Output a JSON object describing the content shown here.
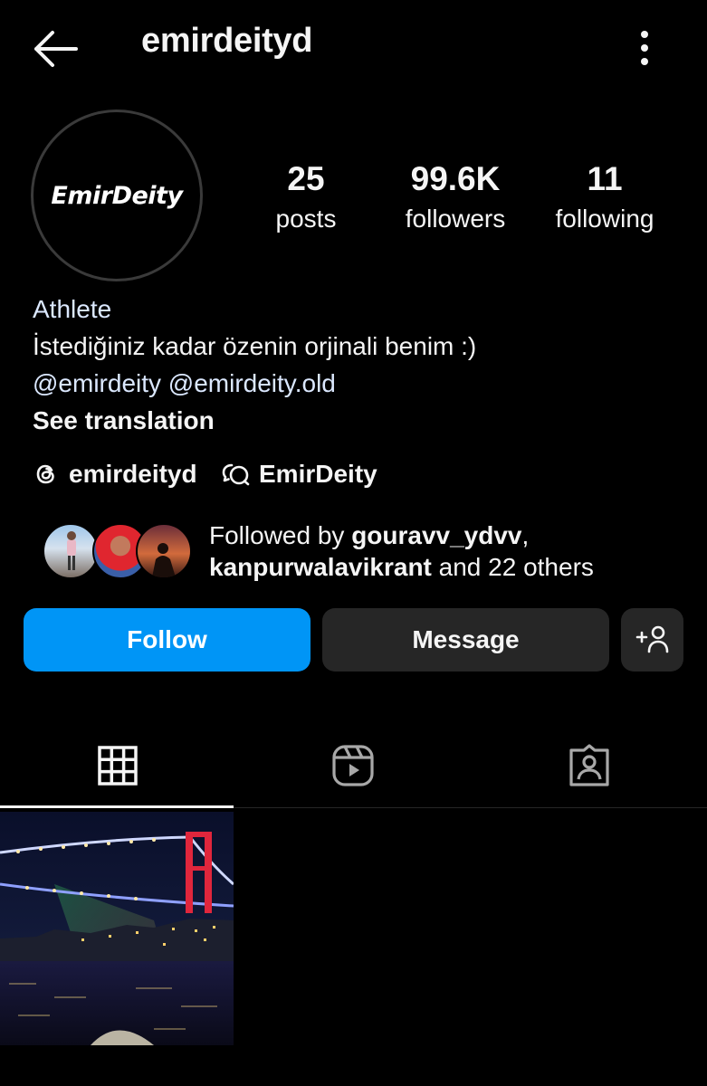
{
  "header": {
    "username": "emirdeityd",
    "back_icon": "arrow-left-icon",
    "more_icon": "more-vertical-icon"
  },
  "profile": {
    "avatar_text": "EmirDeity",
    "stats": [
      {
        "value": "25",
        "label": "posts"
      },
      {
        "value": "99.6K",
        "label": "followers"
      },
      {
        "value": "11",
        "label": "following"
      }
    ],
    "category": "Athlete",
    "bio": "İstediğiniz kadar özenin orjinali benim :)",
    "mentions": "@emirdeity @emirdeity.old",
    "see_translation": "See translation",
    "threads_handle": "emirdeityd",
    "community_name": "EmirDeity"
  },
  "followed_by": {
    "prefix": "Followed by ",
    "user1": "gouravv_ydvv",
    "separator": ",",
    "user2": "kanpurwalavikrant",
    "suffix": " and 22 others"
  },
  "actions": {
    "follow_label": "Follow",
    "message_label": "Message",
    "suggest_icon": "add-person-icon"
  },
  "tabs": [
    {
      "name": "posts",
      "icon": "grid-icon",
      "active": true
    },
    {
      "name": "reels",
      "icon": "reels-icon",
      "active": false
    },
    {
      "name": "tagged",
      "icon": "tagged-icon",
      "active": false
    }
  ],
  "colors": {
    "follow_button": "#0095f6",
    "secondary_button": "#262626",
    "background": "#000000"
  }
}
